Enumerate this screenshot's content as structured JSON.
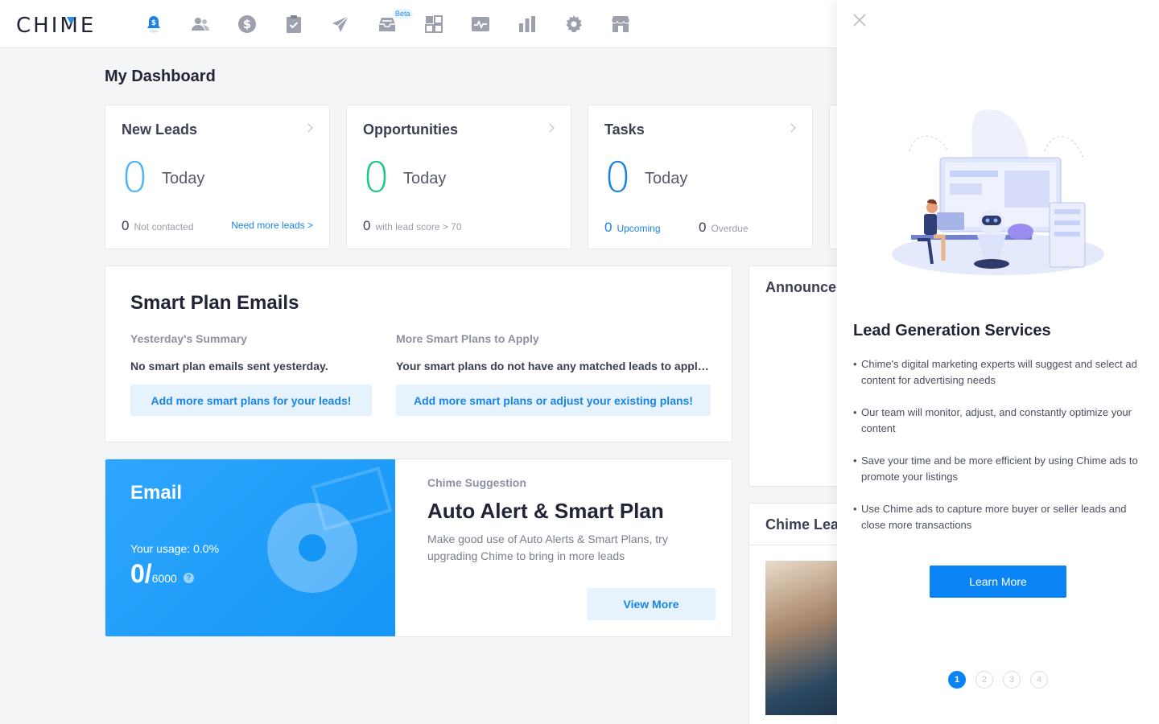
{
  "brand": {
    "logo_text": "CHIME"
  },
  "nav": {
    "items": [
      {
        "name": "alerts-icon",
        "color": "#1a84e6"
      },
      {
        "name": "people-icon",
        "color": "#9ca1ad"
      },
      {
        "name": "dollar-icon",
        "color": "#9ca1ad"
      },
      {
        "name": "clipboard-icon",
        "color": "#9ca1ad"
      },
      {
        "name": "send-icon",
        "color": "#9ca1ad"
      },
      {
        "name": "inbox-icon",
        "color": "#9ca1ad",
        "badge": "Beta"
      },
      {
        "name": "widgets-icon",
        "color": "#9ca1ad"
      },
      {
        "name": "activity-icon",
        "color": "#9ca1ad"
      },
      {
        "name": "bar-chart-icon",
        "color": "#9ca1ad"
      },
      {
        "name": "gear-icon",
        "color": "#9ca1ad"
      },
      {
        "name": "store-icon",
        "color": "#9ca1ad"
      }
    ],
    "beta_label": "Beta"
  },
  "dashboard": {
    "title": "My Dashboard",
    "stats": [
      {
        "title": "New Leads",
        "value": "0",
        "value_color": "#4fb6f5",
        "period": "Today",
        "foot_count": "0",
        "foot_label": "Not contacted",
        "link": "Need more leads >"
      },
      {
        "title": "Opportunities",
        "value": "0",
        "value_color": "#1ec785",
        "period": "Today",
        "foot_count": "0",
        "foot_label": "with lead score > 70"
      },
      {
        "title": "Tasks",
        "value": "0",
        "value_color": "#1a84e6",
        "period": "Today",
        "upcoming_count": "0",
        "upcoming_label": "Upcoming",
        "overdue_count": "0",
        "overdue_label": "Overdue"
      }
    ],
    "smart_plan": {
      "title": "Smart Plan Emails",
      "left": {
        "subtitle": "Yesterday's Summary",
        "message": "No smart plan emails sent yesterday.",
        "button": "Add more smart plans for your leads!"
      },
      "right": {
        "subtitle": "More Smart Plans to Apply",
        "message": "Your smart plans do not have any matched leads to apply to.",
        "button": "Add more smart plans or adjust your existing plans!"
      }
    },
    "email": {
      "title": "Email",
      "usage_label": "Your usage: 0.0%",
      "used": "0",
      "separator": "/",
      "limit": "6000",
      "help": "?",
      "suggestion_label": "Chime Suggestion",
      "suggestion_title": "Auto Alert & Smart Plan",
      "suggestion_desc": "Make good use of Auto Alerts & Smart Plans, try upgrading Chime to bring in more leads",
      "button": "View More"
    },
    "announcements_title": "Announce",
    "chime_lead_title": "Chime Lea"
  },
  "drawer": {
    "title": "Lead Generation Services",
    "bullets": [
      "Chime's digital marketing experts will suggest and select ad content for advertising needs",
      "Our team will monitor, adjust, and constantly optimize your content",
      "Save your time and be more efficient by using Chime ads to promote your listings",
      "Use Chime ads to capture more buyer or seller leads and close more transactions"
    ],
    "button": "Learn More",
    "pages": [
      "1",
      "2",
      "3",
      "4"
    ],
    "active_page": "1"
  }
}
